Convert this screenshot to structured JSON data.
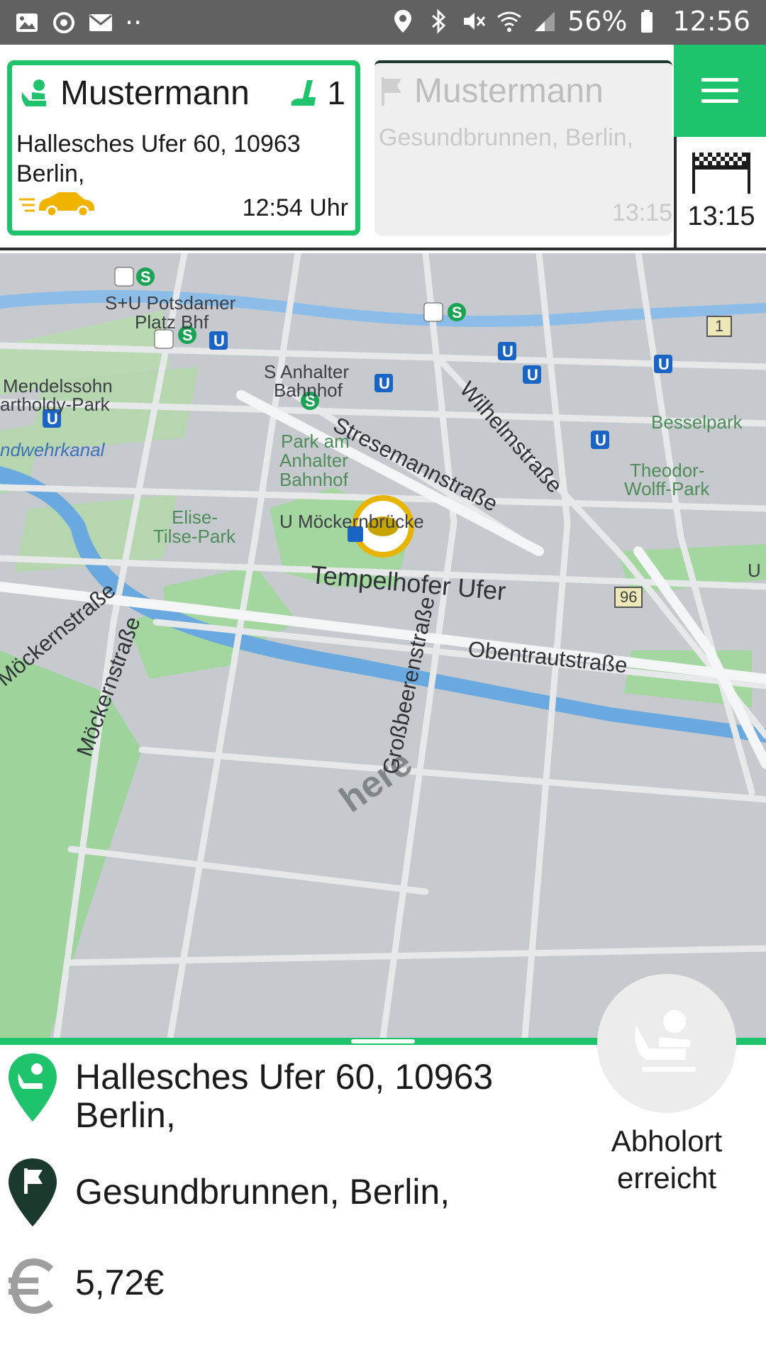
{
  "status_bar": {
    "battery": "56%",
    "time": "12:56",
    "icons": [
      "gallery-icon",
      "sync-icon",
      "mail-icon",
      "more-dots-icon",
      "location-icon",
      "bluetooth-icon",
      "mute-icon",
      "wifi-icon",
      "signal-icon",
      "battery-icon"
    ]
  },
  "current_job": {
    "name": "Mustermann",
    "seats": "1",
    "address": "Hallesches Ufer 60, 10963 Berlin,",
    "time": "12:54 Uhr"
  },
  "next_job": {
    "name": "Mustermann",
    "address": "Gesundbrunnen, Berlin,",
    "time": "13:15"
  },
  "finish_eta": "13:15",
  "map": {
    "labels": {
      "potsdamer": "S+U Potsdamer",
      "platz": "Platz Bhf",
      "anhalter1": "S Anhalter",
      "anhalter2": "Bahnhof",
      "mendelssohn1": "Mendelssohn",
      "mendelssohn2": "artholdy-Park",
      "landwehr": "ndwehrkanal",
      "park1": "Park am",
      "park2": "Anhalter",
      "park3": "Bahnhof",
      "elise1": "Elise-",
      "elise2": "Tilse-Park",
      "moeckernbruecke": "U Möckernbrücke",
      "besselpark": "Besselpark",
      "theodor1": "Theodor-",
      "theodor2": "Wolff-Park",
      "route1": "1",
      "route96": "96",
      "u_edge": "U"
    },
    "streets": {
      "tempelhofer": "Tempelhofer Ufer",
      "stresemann": "Stresemannstraße",
      "wilhelm": "Wilhelmstraße",
      "moeckern1": "Möckernstraße",
      "moeckern2": "Möckernstraße",
      "grossbeeren": "Großbeerenstraße",
      "obentraut": "Obentrautstraße"
    },
    "watermark": "here"
  },
  "details": {
    "pickup_address": "Hallesches Ufer 60, 10963 Berlin,",
    "destination": "Gesundbrunnen, Berlin,",
    "price": "5,72€",
    "pickup_action": "Abholort erreicht"
  },
  "colors": {
    "accent": "#1ec36b",
    "dark_green": "#1b3a2b",
    "water": "#6aa9e0",
    "park": "#9ed39b",
    "marker": "#e8b400"
  }
}
